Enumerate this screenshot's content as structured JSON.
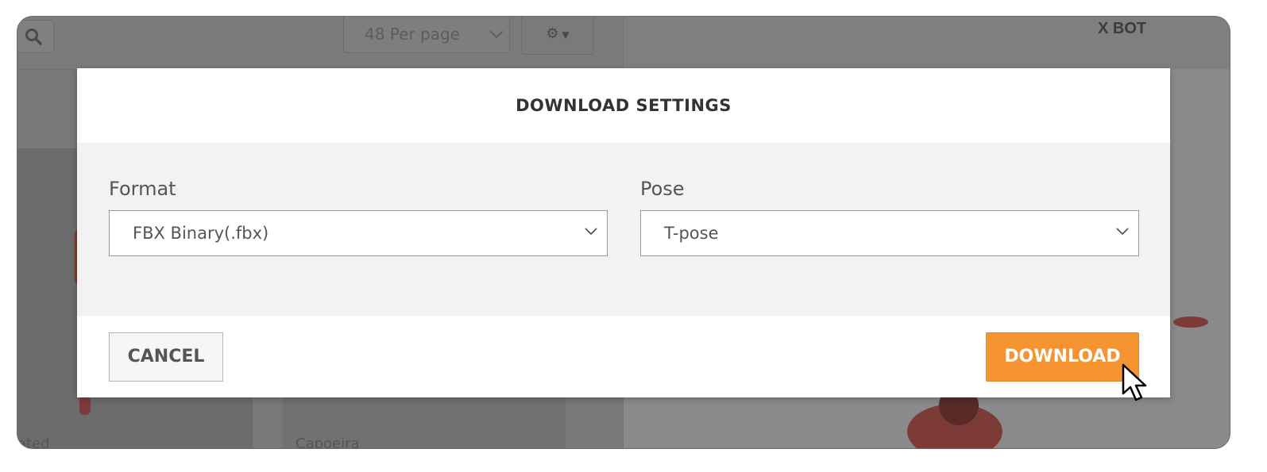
{
  "background": {
    "per_page_label": "48 Per page",
    "character_title": "X BOT",
    "card_label_left": "ated",
    "card_label_right": "Capoeira"
  },
  "modal": {
    "title": "DOWNLOAD SETTINGS",
    "format": {
      "label": "Format",
      "value": "FBX Binary(.fbx)"
    },
    "pose": {
      "label": "Pose",
      "value": "T-pose"
    },
    "cancel_label": "CANCEL",
    "download_label": "DOWNLOAD"
  },
  "colors": {
    "accent": "#f79432",
    "overlay": "#7f7f7f"
  },
  "icons": [
    "search-icon",
    "gear-icon",
    "chevron-down-icon",
    "mouse-pointer-icon"
  ]
}
